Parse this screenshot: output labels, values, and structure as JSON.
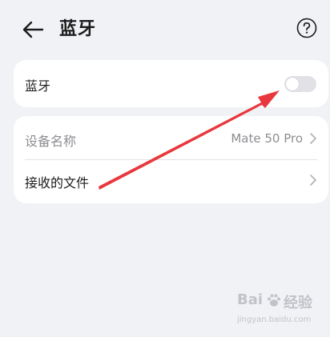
{
  "header": {
    "title": "蓝牙"
  },
  "bluetooth_card": {
    "label": "蓝牙",
    "toggle_on": false
  },
  "device_card": {
    "device_name_label": "设备名称",
    "device_name_value": "Mate 50 Pro",
    "received_files_label": "接收的文件"
  },
  "watermark": {
    "main_left": "Bai",
    "main_right": "经验",
    "sub": "jingyan.baidu.com"
  },
  "colors": {
    "background": "#f1f2f5",
    "card": "#ffffff",
    "secondary_text": "#8e8e93",
    "toggle_off": "#e2e2e6",
    "annotation_arrow": "#e8383d"
  }
}
